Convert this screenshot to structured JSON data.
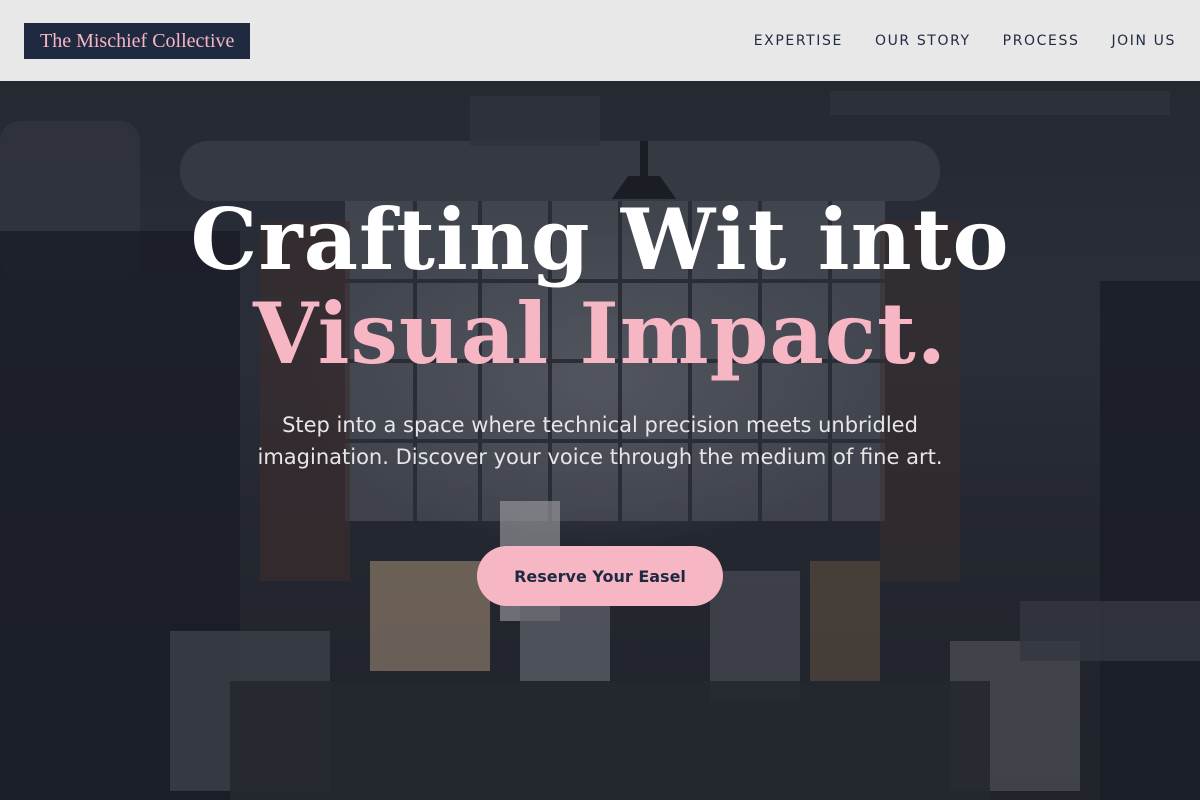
{
  "header": {
    "logo_text": "The Mischief Collective",
    "nav": [
      {
        "label": "EXPERTISE"
      },
      {
        "label": "OUR STORY"
      },
      {
        "label": "PROCESS"
      },
      {
        "label": "JOIN US"
      }
    ]
  },
  "hero": {
    "title_line1": "Crafting Wit into",
    "title_line2": "Visual Impact.",
    "subtitle": "Step into a space where technical precision meets unbridled imagination. Discover your voice through the medium of fine art.",
    "cta_label": "Reserve Your Easel",
    "background": "art-studio-photo"
  },
  "colors": {
    "accent_pink": "#f7b6c4",
    "navy": "#1f2a40",
    "header_bg": "#e8e8e8"
  }
}
